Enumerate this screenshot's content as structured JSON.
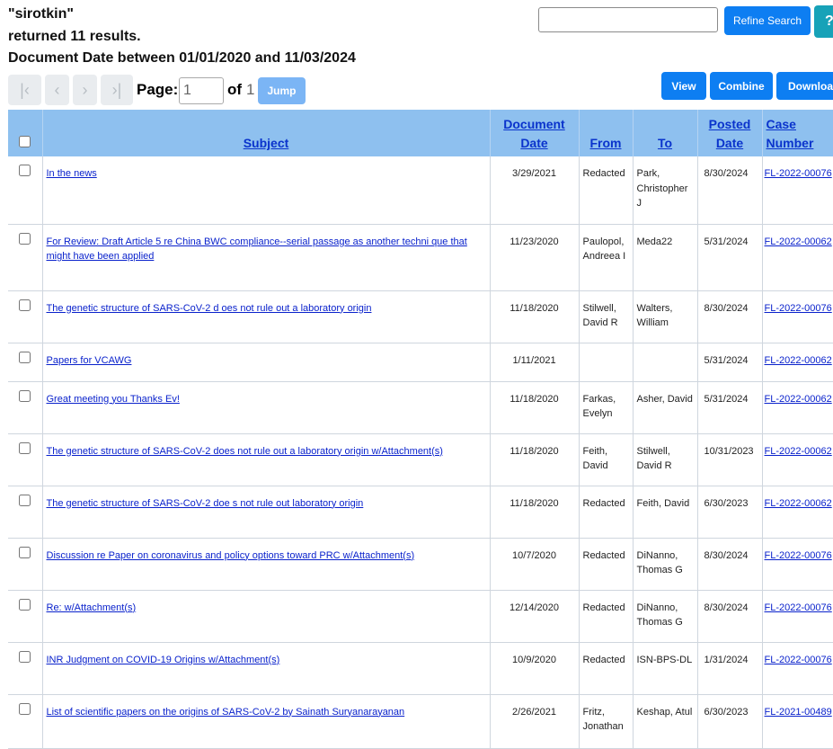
{
  "header": {
    "query": "\"sirotkin\"",
    "results": "returned 11 results.",
    "date_range": "Document Date between 01/01/2020 and 11/03/2024"
  },
  "search": {
    "value": "",
    "placeholder": "",
    "refine_label": "Refine Search",
    "help_label": "?"
  },
  "pagination": {
    "first_icon": "first-page-icon",
    "prev_icon": "prev-page-icon",
    "next_icon": "next-page-icon",
    "last_icon": "last-page-icon",
    "page_label": "Page:",
    "current_page": "1",
    "of_label": "of",
    "total_pages": "1",
    "jump_label": "Jump"
  },
  "actions": {
    "view": "View",
    "combine": "Combine",
    "download": "Download"
  },
  "table": {
    "headers": {
      "subject": "Subject",
      "doc_date_1": "Document",
      "doc_date_2": "Date",
      "from": "From",
      "to": "To",
      "posted_1": "Posted",
      "posted_2": "Date",
      "case_1": "Case",
      "case_2": "Number"
    },
    "rows": [
      {
        "subject": "In the news",
        "doc_date": "3/29/2021",
        "from": "Redacted",
        "to": "Park, Christopher J",
        "posted": "8/30/2024",
        "case": "FL-2022-00076"
      },
      {
        "subject": "For Review: Draft Article 5 re China BWC compliance--serial passage as another techni que that might have been applied",
        "doc_date": "11/23/2020",
        "from": "Paulopol, Andreea I",
        "to": "Meda22",
        "posted": "5/31/2024",
        "case": "FL-2022-00062"
      },
      {
        "subject": "The genetic structure of SARS-CoV-2 d oes not rule out a laboratory origin",
        "doc_date": "11/18/2020",
        "from": "Stilwell, David R",
        "to": "Walters, William",
        "posted": "8/30/2024",
        "case": "FL-2022-00076"
      },
      {
        "subject": "Papers for VCAWG",
        "doc_date": "1/11/2021",
        "from": "",
        "to": "",
        "posted": "5/31/2024",
        "case": "FL-2022-00062"
      },
      {
        "subject": "Great meeting you Thanks Ev!",
        "doc_date": "11/18/2020",
        "from": "Farkas, Evelyn",
        "to": "Asher, David",
        "posted": "5/31/2024",
        "case": "FL-2022-00062"
      },
      {
        "subject": "The genetic structure of SARS-CoV-2 does not rule out a laboratory origin w/Attachment(s)",
        "doc_date": "11/18/2020",
        "from": "Feith, David",
        "to": "Stilwell, David R",
        "posted": "10/31/2023",
        "case": "FL-2022-00062"
      },
      {
        "subject": "The genetic structure of SARS-CoV-2 doe s not rule out laboratory origin",
        "doc_date": "11/18/2020",
        "from": "Redacted",
        "to": "Feith, David",
        "posted": "6/30/2023",
        "case": "FL-2022-00062"
      },
      {
        "subject": "Discussion re Paper on coronavirus and policy options toward PRC w/Attachment(s)",
        "doc_date": "10/7/2020",
        "from": "Redacted",
        "to": "DiNanno, Thomas G",
        "posted": "8/30/2024",
        "case": "FL-2022-00076"
      },
      {
        "subject": "Re: w/Attachment(s)",
        "doc_date": "12/14/2020",
        "from": "Redacted",
        "to": "DiNanno, Thomas G",
        "posted": "8/30/2024",
        "case": "FL-2022-00076"
      },
      {
        "subject": "INR Judgment on COVID-19 Origins w/Attachment(s)",
        "doc_date": "10/9/2020",
        "from": "Redacted",
        "to": "ISN-BPS-DL",
        "posted": "1/31/2024",
        "case": "FL-2022-00076"
      },
      {
        "subject": "List of scientific papers on the origins of SARS-CoV-2 by Sainath Suryanarayanan",
        "doc_date": "2/26/2021",
        "from": "Fritz, Jonathan",
        "to": "Keshap, Atul",
        "posted": "6/30/2023",
        "case": "FL-2021-00489"
      }
    ]
  }
}
